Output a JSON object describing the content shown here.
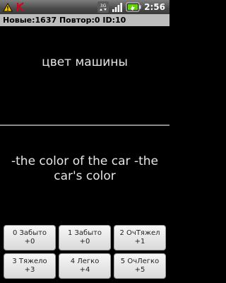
{
  "status_bar": {
    "time": "2:56",
    "icons": [
      "warning-icon",
      "kaspersky-icon",
      "3g-signal-icon",
      "signal-bars-icon",
      "battery-icon"
    ]
  },
  "info_bar": {
    "text": "Новые:1637 Повтор:0 ID:10"
  },
  "card": {
    "question": "цвет машины",
    "answer": "-the color of the car -the car's color"
  },
  "buttons": [
    {
      "label": "0 Забыто",
      "value": "+0"
    },
    {
      "label": "1 Забыто",
      "value": "+0"
    },
    {
      "label": "2 ОчТяжел",
      "value": "+1"
    },
    {
      "label": "3 Тяжело",
      "value": "+3"
    },
    {
      "label": "4 Легко",
      "value": "+4"
    },
    {
      "label": "5 ОчЛегко",
      "value": "+5"
    }
  ],
  "colors": {
    "background": "#000000",
    "info_bar": "#bdbdbd",
    "divider": "#8a8a8a",
    "text": "#e6e6e6"
  }
}
